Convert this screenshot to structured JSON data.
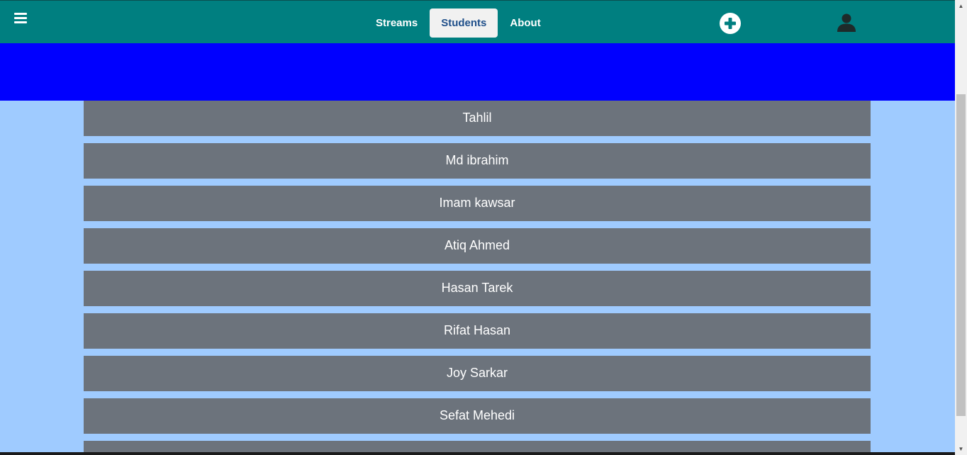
{
  "navbar": {
    "menu_icon": "hamburger-menu-icon",
    "links": [
      {
        "label": "Streams",
        "active": false
      },
      {
        "label": "Students",
        "active": true
      },
      {
        "label": "About",
        "active": false
      }
    ],
    "add_icon": "plus-circle-icon",
    "profile_icon": "user-silhouette-icon",
    "colors": {
      "navbar_bg": "#007f80",
      "active_tab_bg": "#f1f1f1",
      "active_tab_text": "#1f4f8a"
    }
  },
  "banner": {
    "color": "#0000ff"
  },
  "students": [
    "Tahlil",
    "Md ibrahim",
    "Imam kawsar",
    "Atiq Ahmed",
    "Hasan Tarek",
    "Rifat Hasan",
    "Joy Sarkar",
    "Sefat Mehedi"
  ],
  "colors": {
    "page_bg": "#9fcbff",
    "list_item_bg": "#6c737c",
    "list_item_text": "#ffffff"
  }
}
